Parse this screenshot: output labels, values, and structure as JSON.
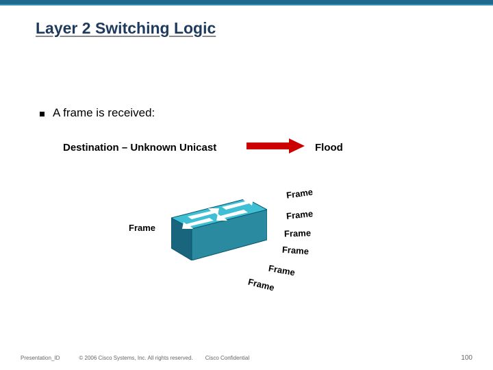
{
  "title": "Layer 2 Switching Logic",
  "bullet": "A frame is received:",
  "subhead": "Destination – Unknown Unicast",
  "flood_label": "Flood",
  "frame_labels": {
    "left": "Frame",
    "r1": "Frame",
    "r2": "Frame",
    "r3": "Frame",
    "r4": "Frame",
    "r5": "Frame",
    "r6": "Frame"
  },
  "footer": {
    "presentation_id": "Presentation_ID",
    "copyright": "© 2006 Cisco Systems, Inc. All rights reserved.",
    "confidential": "Cisco Confidential",
    "page_number": "100"
  },
  "colors": {
    "topbar": "#1e6a8e",
    "title": "#1e3a5c",
    "arrow": "#cc0000",
    "switch_top": "#3fbfd4",
    "switch_side": "#2a8aa0"
  }
}
